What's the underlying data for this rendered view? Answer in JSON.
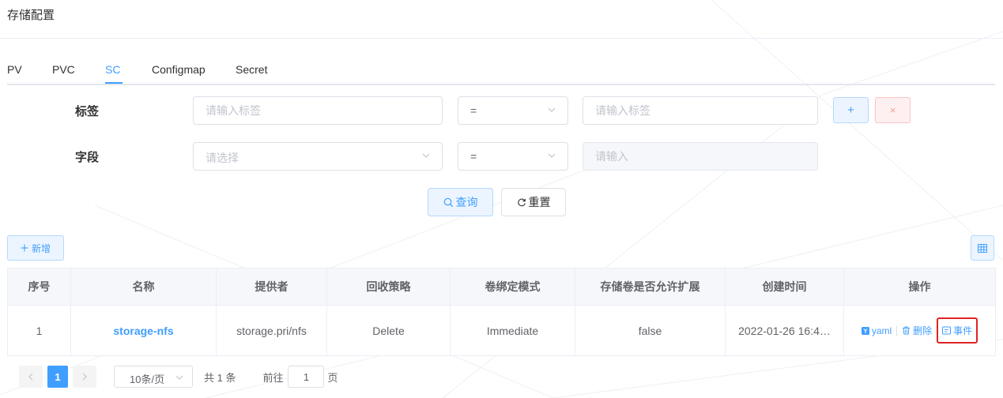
{
  "page": {
    "title": "存储配置"
  },
  "tabs": [
    {
      "label": "PV",
      "active": false
    },
    {
      "label": "PVC",
      "active": false
    },
    {
      "label": "SC",
      "active": true
    },
    {
      "label": "Configmap",
      "active": false
    },
    {
      "label": "Secret",
      "active": false
    }
  ],
  "filter": {
    "label_row": {
      "label": "标签",
      "key_placeholder": "请输入标签",
      "operator": "=",
      "value_placeholder": "请输入标签",
      "add_symbol": "+",
      "remove_symbol": "×"
    },
    "field_row": {
      "label": "字段",
      "field_placeholder": "请选择",
      "operator": "=",
      "value_placeholder": "请输入"
    },
    "query_label": "查询",
    "reset_label": "重置"
  },
  "toolbar": {
    "add_label": "新增"
  },
  "table": {
    "columns": [
      "序号",
      "名称",
      "提供者",
      "回收策略",
      "卷绑定模式",
      "存储卷是否允许扩展",
      "创建时间",
      "操作"
    ],
    "rows": [
      {
        "index": "1",
        "name": "storage-nfs",
        "provisioner": "storage.pri/nfs",
        "reclaim_policy": "Delete",
        "binding_mode": "Immediate",
        "allow_expansion": "false",
        "created": "2022-01-26 16:4…"
      }
    ],
    "actions": {
      "yaml": "yaml",
      "delete": "删除",
      "events": "事件"
    }
  },
  "pagination": {
    "current_page": "1",
    "page_size": "10条/页",
    "total": "共 1 条",
    "goto_prefix": "前往",
    "goto_value": "1",
    "goto_suffix": "页"
  },
  "colors": {
    "primary": "#409eff",
    "danger": "#f56c6c",
    "highlight_box": "#e02424"
  }
}
